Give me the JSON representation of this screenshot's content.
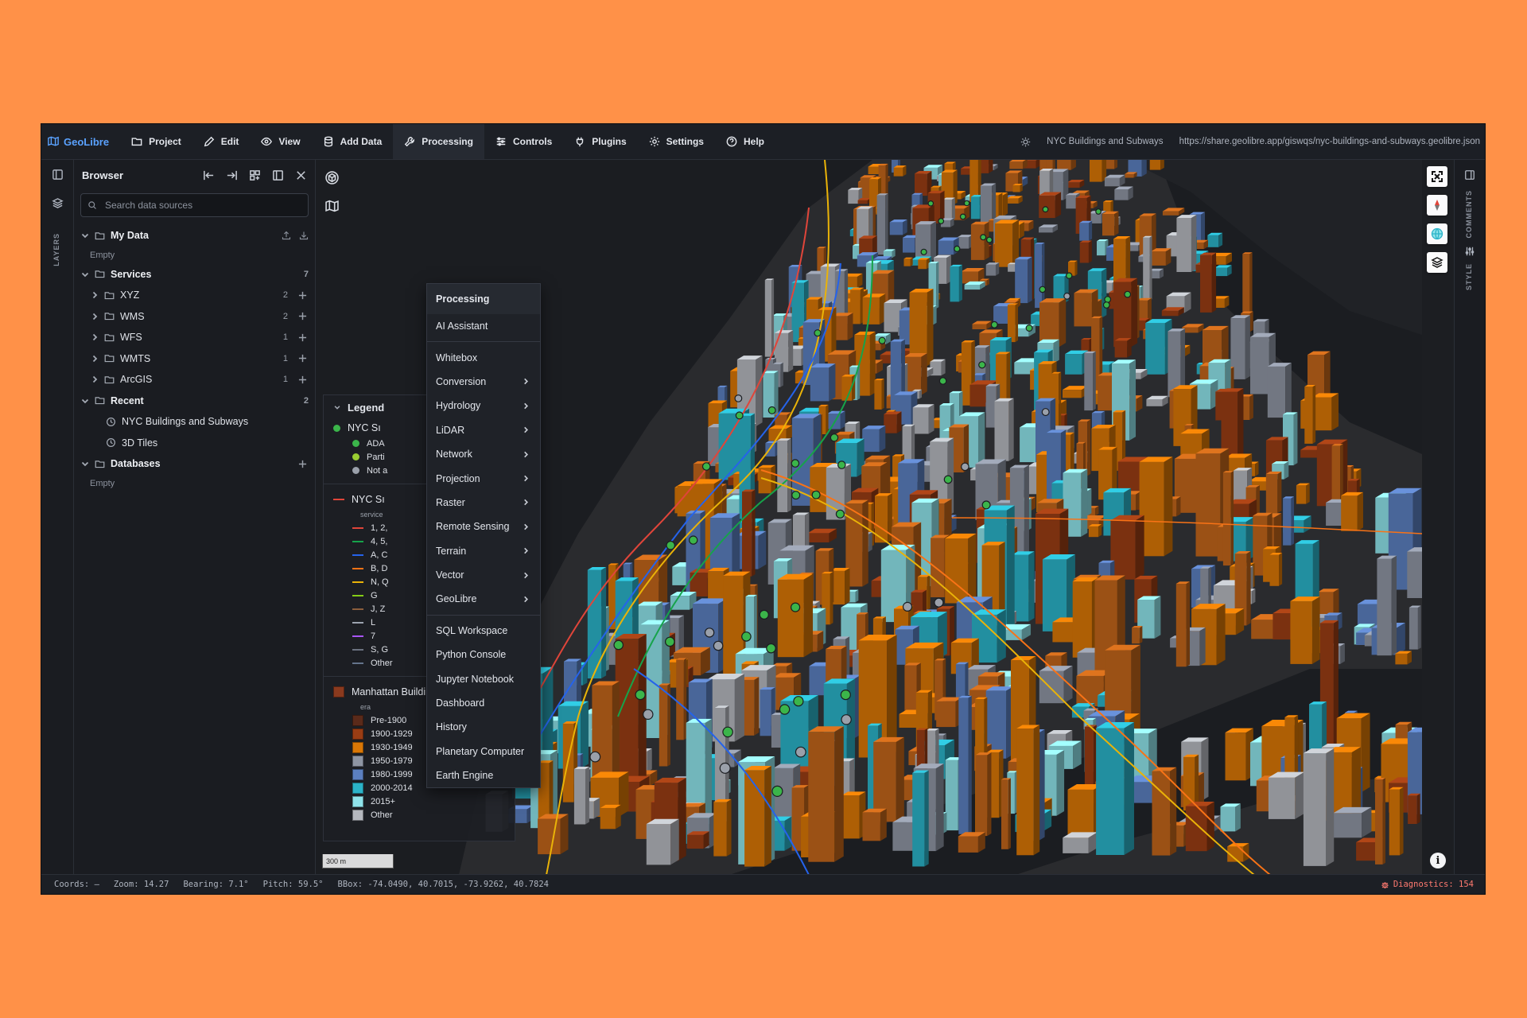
{
  "app": {
    "brand": "GeoLibre",
    "menu": [
      {
        "label": "Project",
        "icon": "folder-icon"
      },
      {
        "label": "Edit",
        "icon": "pencil-icon"
      },
      {
        "label": "View",
        "icon": "eye-icon"
      },
      {
        "label": "Add Data",
        "icon": "database-icon"
      },
      {
        "label": "Processing",
        "icon": "wrench-icon"
      },
      {
        "label": "Controls",
        "icon": "sliders-icon"
      },
      {
        "label": "Plugins",
        "icon": "plug-icon"
      },
      {
        "label": "Settings",
        "icon": "gear-icon"
      },
      {
        "label": "Help",
        "icon": "help-icon"
      }
    ],
    "project_name": "NYC Buildings and Subways",
    "share_url": "https://share.geolibre.app/giswqs/nyc-buildings-and-subways.geolibre.json"
  },
  "rail": {
    "layers_label": "LAYERS"
  },
  "right_rail": {
    "comments_label": "COMMENTS",
    "style_label": "STYLE"
  },
  "browser": {
    "title": "Browser",
    "search_placeholder": "Search data sources",
    "my_data": {
      "label": "My Data",
      "empty": "Empty"
    },
    "services": {
      "label": "Services",
      "count": "7",
      "items": [
        {
          "label": "XYZ",
          "count": "2"
        },
        {
          "label": "WMS",
          "count": "2"
        },
        {
          "label": "WFS",
          "count": "1"
        },
        {
          "label": "WMTS",
          "count": "1"
        },
        {
          "label": "ArcGIS",
          "count": "1"
        }
      ]
    },
    "recent": {
      "label": "Recent",
      "count": "2",
      "items": [
        {
          "label": "NYC Buildings and Subways"
        },
        {
          "label": "3D Tiles"
        }
      ]
    },
    "databases": {
      "label": "Databases",
      "empty": "Empty"
    }
  },
  "processing_menu": {
    "title": "Processing",
    "items": [
      {
        "label": "AI Assistant",
        "submenu": false
      },
      {
        "label": "Whitebox",
        "submenu": false
      },
      {
        "label": "Conversion",
        "submenu": true
      },
      {
        "label": "Hydrology",
        "submenu": true
      },
      {
        "label": "LiDAR",
        "submenu": true
      },
      {
        "label": "Network",
        "submenu": true
      },
      {
        "label": "Projection",
        "submenu": true
      },
      {
        "label": "Raster",
        "submenu": true
      },
      {
        "label": "Remote Sensing",
        "submenu": true
      },
      {
        "label": "Terrain",
        "submenu": true
      },
      {
        "label": "Vector",
        "submenu": true
      },
      {
        "label": "GeoLibre",
        "submenu": true
      },
      {
        "label": "SQL Workspace",
        "submenu": false
      },
      {
        "label": "Python Console",
        "submenu": false
      },
      {
        "label": "Jupyter Notebook",
        "submenu": false
      },
      {
        "label": "Dashboard",
        "submenu": false
      },
      {
        "label": "History",
        "submenu": false
      },
      {
        "label": "Planetary Computer",
        "submenu": false
      },
      {
        "label": "Earth Engine",
        "submenu": false
      }
    ]
  },
  "legend": {
    "title": "Legend",
    "stations": {
      "title": "NYC Sı",
      "color": "#3bb54a",
      "items": [
        {
          "label": "ADA",
          "color": "#3bb54a"
        },
        {
          "label": "Parti",
          "color": "#9acd32"
        },
        {
          "label": "Not a",
          "color": "#9aa0aa"
        }
      ]
    },
    "lines": {
      "title": "NYC Sı",
      "color": "#e0453a",
      "field": "service",
      "items": [
        {
          "label": "1, 2,",
          "color": "#e0453a"
        },
        {
          "label": "4, 5,",
          "color": "#16a34a"
        },
        {
          "label": "A, C",
          "color": "#2563eb"
        },
        {
          "label": "B, D",
          "color": "#f97316"
        },
        {
          "label": "N, Q",
          "color": "#eab308"
        },
        {
          "label": "G",
          "color": "#84cc16"
        },
        {
          "label": "J, Z",
          "color": "#8b5e3c"
        },
        {
          "label": "L",
          "color": "#9ca3af"
        },
        {
          "label": "7",
          "color": "#a855f7"
        },
        {
          "label": "S, G",
          "color": "#6b7280"
        },
        {
          "label": "Other",
          "color": "#64748b"
        }
      ]
    },
    "heights": {
      "title": "Manhattan Building Heights",
      "color": "#8a3a1e",
      "field": "era",
      "items": [
        {
          "label": "Pre-1900",
          "color": "#5a2a1a"
        },
        {
          "label": "1900-1929",
          "color": "#9a3d14"
        },
        {
          "label": "1930-1949",
          "color": "#d97706"
        },
        {
          "label": "1950-1979",
          "color": "#8e95a3"
        },
        {
          "label": "1980-1999",
          "color": "#5b7fbf"
        },
        {
          "label": "2000-2014",
          "color": "#2bb3c8"
        },
        {
          "label": "2015+",
          "color": "#8fe3ea"
        },
        {
          "label": "Other",
          "color": "#b5b8be"
        }
      ]
    }
  },
  "map": {
    "scale_label": "300 m"
  },
  "status": {
    "coords": "Coords: —",
    "zoom": "Zoom: 14.27",
    "bearing": "Bearing: 7.1°",
    "pitch": "Pitch: 59.5°",
    "bbox": "BBox: -74.0490, 40.7015, -73.9262, 40.7824",
    "diagnostics": "Diagnostics: 154"
  }
}
